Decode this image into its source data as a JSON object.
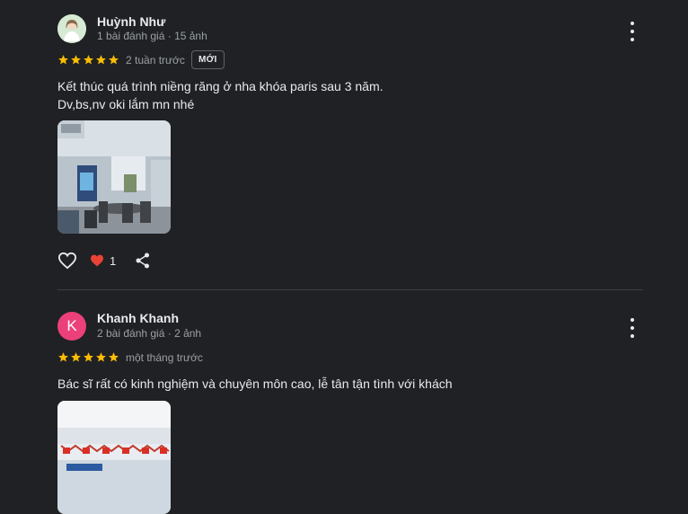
{
  "reviews": [
    {
      "author": "Huỳnh Như",
      "meta": "1 bài đánh giá · 15 ảnh",
      "rating": 5,
      "time": "2 tuần trước",
      "badge": "MỚI",
      "text_lines": [
        "Kết thúc quá trình niềng răng ở nha khóa paris sau 3 năm.",
        "Dv,bs,nv oki lắm mn nhé"
      ],
      "like_count": "1",
      "avatar_color": "#cfe3c9"
    },
    {
      "author": "Khanh Khanh",
      "avatar_letter": "K",
      "meta": "2 bài đánh giá · 2 ảnh",
      "rating": 5,
      "time": "một tháng trước",
      "text_lines": [
        "Bác sĩ rất có kinh nghiệm và chuyên môn cao, lễ tân tận tình với khách"
      ],
      "avatar_color": "#ec407a"
    }
  ],
  "colors": {
    "star": "#fbbc04",
    "heart": "#ea4335",
    "background": "#202124"
  },
  "icons": [
    "more-vert-icon",
    "star-icon",
    "heart-outline-icon",
    "heart-filled-icon",
    "share-icon"
  ]
}
